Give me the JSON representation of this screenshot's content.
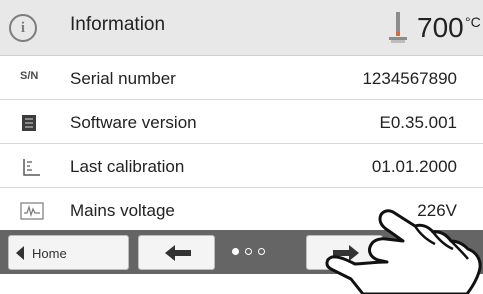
{
  "header": {
    "title": "Information",
    "temperature": "700",
    "temperature_unit": "°C"
  },
  "rows": [
    {
      "icon": "serial-number-icon",
      "icon_text": "S/N",
      "label": "Serial number",
      "value": "1234567890"
    },
    {
      "icon": "software-version-icon",
      "label": "Software version",
      "value": "E0.35.001"
    },
    {
      "icon": "calibration-icon",
      "label": "Last calibration",
      "value": "01.01.2000"
    },
    {
      "icon": "mains-voltage-icon",
      "label": "Mains voltage",
      "value": "226V"
    }
  ],
  "footer": {
    "home_label": "Home",
    "page_indicator": {
      "current": 1,
      "total": 3
    }
  },
  "colors": {
    "header_bg": "#e8e8e8",
    "footer_bg": "#656565",
    "text": "#222222"
  }
}
